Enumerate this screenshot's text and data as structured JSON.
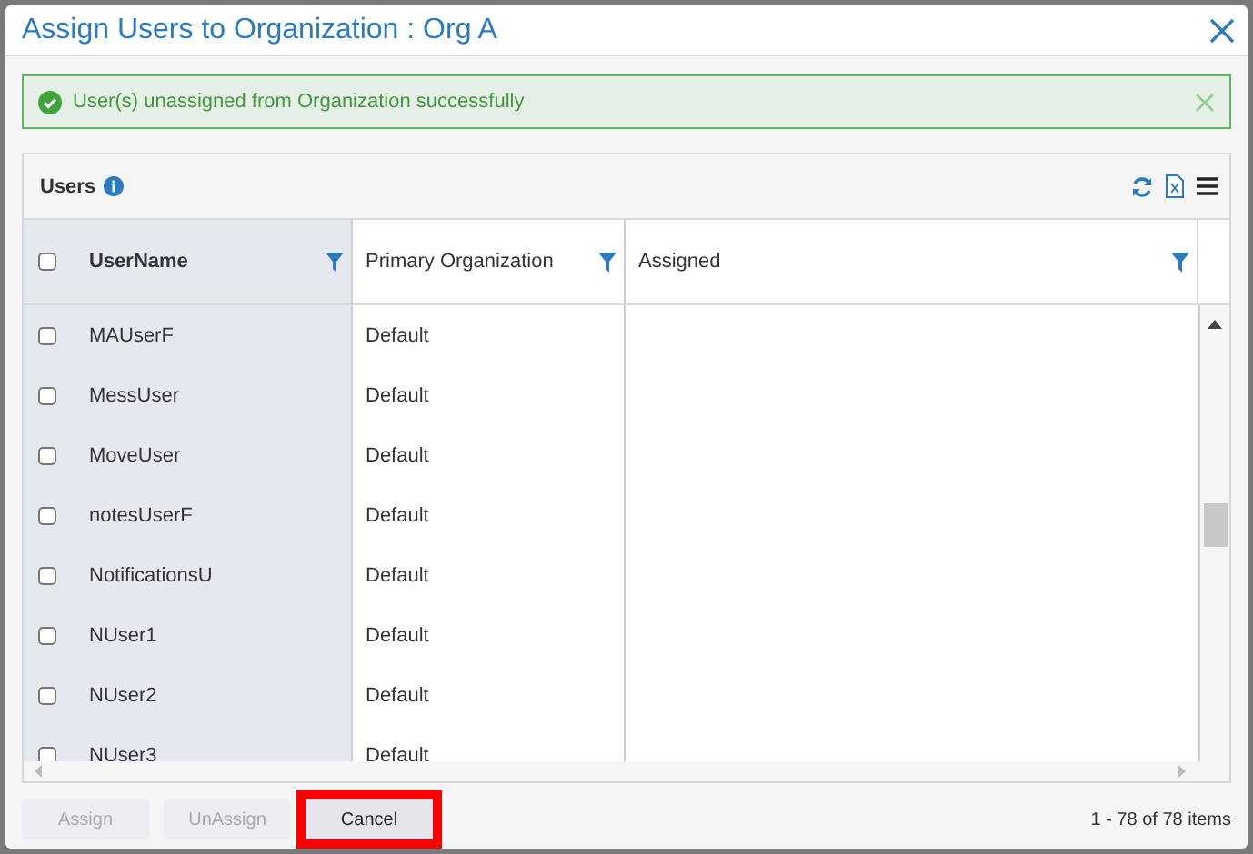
{
  "dialog": {
    "title": "Assign Users to Organization : Org A"
  },
  "alert": {
    "message": "User(s) unassigned from Organization successfully"
  },
  "grid": {
    "title": "Users",
    "columns": [
      {
        "label": "UserName"
      },
      {
        "label": "Primary Organization"
      },
      {
        "label": "Assigned"
      }
    ],
    "header_checked": false,
    "rows": [
      {
        "checked": false,
        "username": "MAUserF",
        "organization": "Default"
      },
      {
        "checked": false,
        "username": "MessUser",
        "organization": "Default"
      },
      {
        "checked": false,
        "username": "MoveUser",
        "organization": "Default"
      },
      {
        "checked": false,
        "username": "notesUserF",
        "organization": "Default"
      },
      {
        "checked": false,
        "username": "NotificationsU",
        "organization": "Default"
      },
      {
        "checked": false,
        "username": "NUser1",
        "organization": "Default"
      },
      {
        "checked": false,
        "username": "NUser2",
        "organization": "Default"
      },
      {
        "checked": false,
        "username": "NUser3",
        "organization": "Default"
      }
    ]
  },
  "buttons": [
    {
      "label": "Assign",
      "disabled": true,
      "highlighted": false
    },
    {
      "label": "UnAssign",
      "disabled": true,
      "highlighted": false
    },
    {
      "label": "Cancel",
      "disabled": false,
      "highlighted": true
    }
  ],
  "pager": {
    "summary": "1 - 78 of 78 items"
  }
}
